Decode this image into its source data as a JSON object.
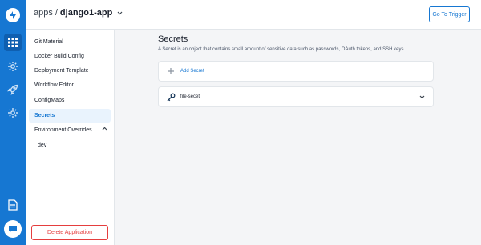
{
  "rail": {
    "icons": [
      "devtron-logo-icon",
      "apps-grid-icon",
      "global-config-gear-icon",
      "deploy-rocket-icon",
      "settings-gear-icon",
      "docs-icon",
      "chat-support-icon"
    ]
  },
  "header": {
    "breadcrumb_apps": "apps",
    "breadcrumb_sep": "/",
    "app_name": "django1-app",
    "trigger_label": "Go To Trigger"
  },
  "sidebar": {
    "items": [
      {
        "label": "Git Material"
      },
      {
        "label": "Docker Build Config"
      },
      {
        "label": "Deployment Template"
      },
      {
        "label": "Workflow Editor"
      },
      {
        "label": "ConfigMaps"
      },
      {
        "label": "Secrets"
      },
      {
        "label": "Environment Overrides"
      }
    ],
    "active": "Secrets",
    "env_sub_items": [
      {
        "label": "dev"
      }
    ],
    "delete_label": "Delete Application"
  },
  "main": {
    "title": "Secrets",
    "description": "A Secret is an object that contains small amount of sensitive data such as passwords, OAuth tokens, and SSH keys.",
    "add_label": "Add Secret",
    "secrets": [
      {
        "name": "file-secet"
      }
    ]
  },
  "colors": {
    "accent": "#1677d2",
    "danger": "#e53e3e"
  }
}
